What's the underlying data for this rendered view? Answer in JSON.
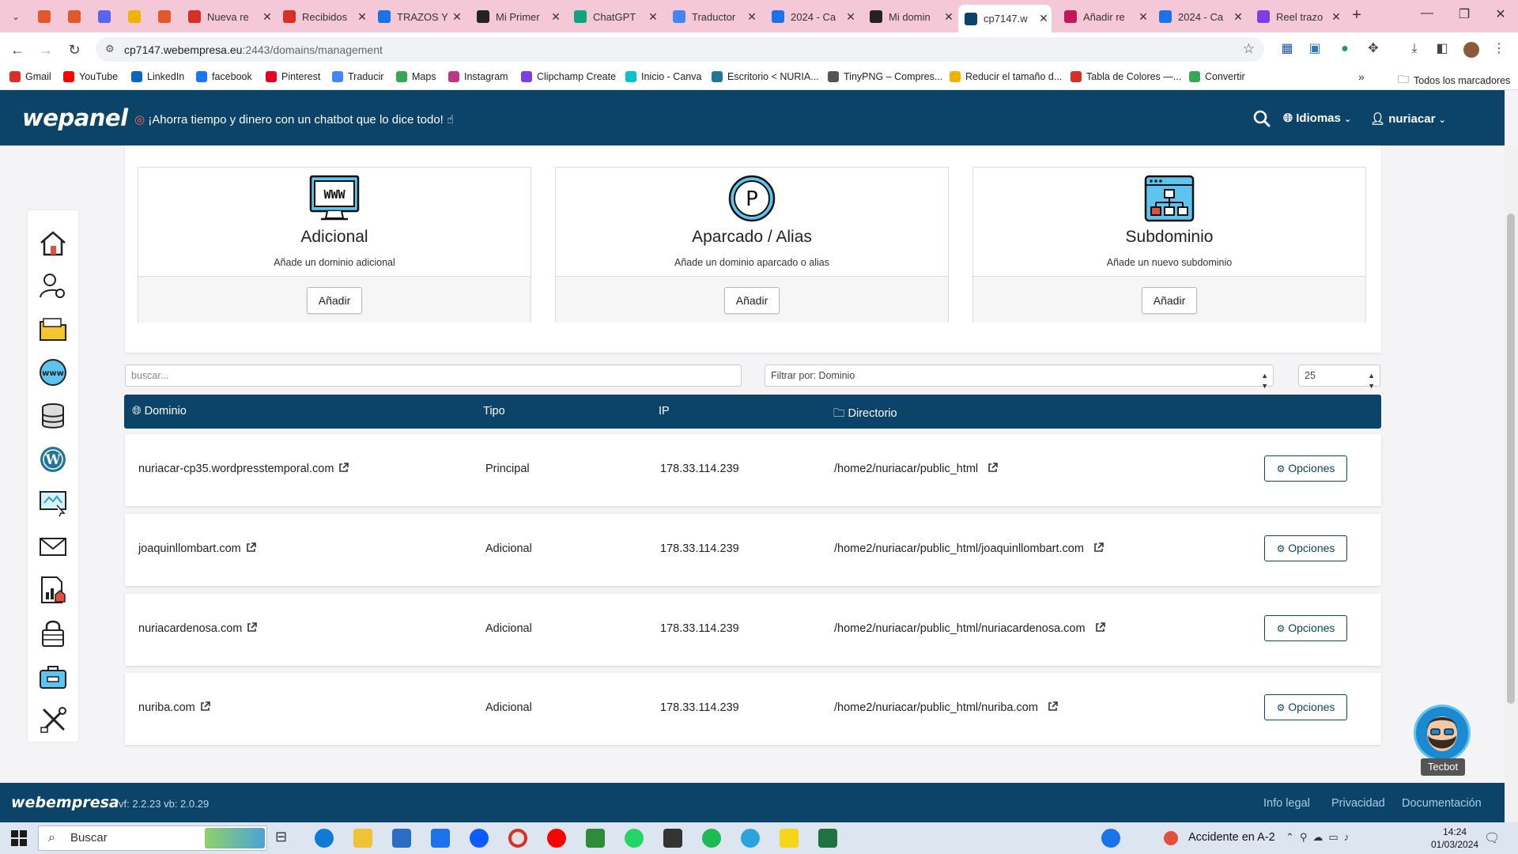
{
  "browser": {
    "tabs": [
      {
        "title": "",
        "color": "#e25828"
      },
      {
        "title": "",
        "color": "#e25828"
      },
      {
        "title": "",
        "color": "#5865f2"
      },
      {
        "title": "",
        "color": "#f0b400"
      },
      {
        "title": "",
        "color": "#e25828"
      },
      {
        "title": "Nueva re",
        "color": "#d93025"
      },
      {
        "title": "Recibidos",
        "color": "#d93025"
      },
      {
        "title": "TRAZOS Y",
        "color": "#1a73e8"
      },
      {
        "title": "Mi Primer",
        "color": "#222222"
      },
      {
        "title": "ChatGPT",
        "color": "#10a37f"
      },
      {
        "title": "Traductor",
        "color": "#4285f4"
      },
      {
        "title": "2024 - Ca",
        "color": "#1a73e8"
      },
      {
        "title": "Mi domin",
        "color": "#222222"
      },
      {
        "title": "cp7147.w",
        "color": "#0b4468"
      },
      {
        "title": "Añadir re",
        "color": "#c2185b"
      },
      {
        "title": "2024 - Ca",
        "color": "#1a73e8"
      },
      {
        "title": "Reel trazo",
        "color": "#7b3fe4"
      }
    ],
    "url_host": "cp7147.webempresa.eu",
    "url_path": ":2443/domains/management",
    "bookmarks": [
      {
        "label": "Gmail",
        "color": "#d93025"
      },
      {
        "label": "YouTube",
        "color": "#ff0000"
      },
      {
        "label": "LinkedIn",
        "color": "#0a66c2"
      },
      {
        "label": "facebook",
        "color": "#1877f2"
      },
      {
        "label": "Pinterest",
        "color": "#e60023"
      },
      {
        "label": "Traducir",
        "color": "#4285f4"
      },
      {
        "label": "Maps",
        "color": "#34a853"
      },
      {
        "label": "Instagram",
        "color": "#c13584"
      },
      {
        "label": "Clipchamp Create",
        "color": "#7b3fe4"
      },
      {
        "label": "Inicio - Canva",
        "color": "#00c4cc"
      },
      {
        "label": "Escritorio < NURIA...",
        "color": "#21759b"
      },
      {
        "label": "TinyPNG – Compres...",
        "color": "#555555"
      },
      {
        "label": "Reducir el tamaño d...",
        "color": "#f0b400"
      },
      {
        "label": "Tabla de Colores —...",
        "color": "#d93025"
      },
      {
        "label": "Convertir",
        "color": "#34a853"
      }
    ],
    "all_bookmarks": "Todos los marcadores"
  },
  "header": {
    "logo": "wepanel",
    "promo": "¡Ahorra tiempo y dinero con un chatbot que lo dice todo!",
    "languages": "Idiomas",
    "user": "nuriacar"
  },
  "cards": [
    {
      "title": "Adicional",
      "subtitle": "Añade un dominio adicional",
      "button": "Añadir",
      "icon": "www-monitor-icon"
    },
    {
      "title": "Aparcado / Alias",
      "subtitle": "Añade un dominio aparcado o alias",
      "button": "Añadir",
      "icon": "parking-icon"
    },
    {
      "title": "Subdominio",
      "subtitle": "Añade un nuevo subdominio",
      "button": "Añadir",
      "icon": "sitemap-icon"
    }
  ],
  "filters": {
    "search_placeholder": "buscar...",
    "filter_value": "Filtrar por: Dominio",
    "per_page": "25"
  },
  "table": {
    "headers": [
      "Dominio",
      "Tipo",
      "IP",
      "Directorio"
    ],
    "rows": [
      {
        "domain": "nuriacar-cp35.wordpresstemporal.com",
        "type": "Principal",
        "ip": "178.33.114.239",
        "dir": "/home2/nuriacar/public_html",
        "action": "Opciones"
      },
      {
        "domain": "joaquinllombart.com",
        "type": "Adicional",
        "ip": "178.33.114.239",
        "dir": "/home2/nuriacar/public_html/joaquinllombart.com",
        "action": "Opciones"
      },
      {
        "domain": "nuriacardenosa.com",
        "type": "Adicional",
        "ip": "178.33.114.239",
        "dir": "/home2/nuriacar/public_html/nuriacardenosa.com",
        "action": "Opciones"
      },
      {
        "domain": "nuriba.com",
        "type": "Adicional",
        "ip": "178.33.114.239",
        "dir": "/home2/nuriacar/public_html/nuriba.com",
        "action": "Opciones"
      }
    ]
  },
  "footer": {
    "logo": "webempresa",
    "version": "vf: 2.2.23 vb: 2.0.29",
    "links": [
      "Info legal",
      "Privacidad",
      "Documentación"
    ]
  },
  "tecbot": "Tecbot",
  "taskbar": {
    "search": "Buscar",
    "news": "Accidente en A-2",
    "time": "14:24",
    "date": "01/03/2024"
  },
  "colors": {
    "brand_dark": "#0b4468",
    "tab_strip": "#f5c8d8"
  }
}
